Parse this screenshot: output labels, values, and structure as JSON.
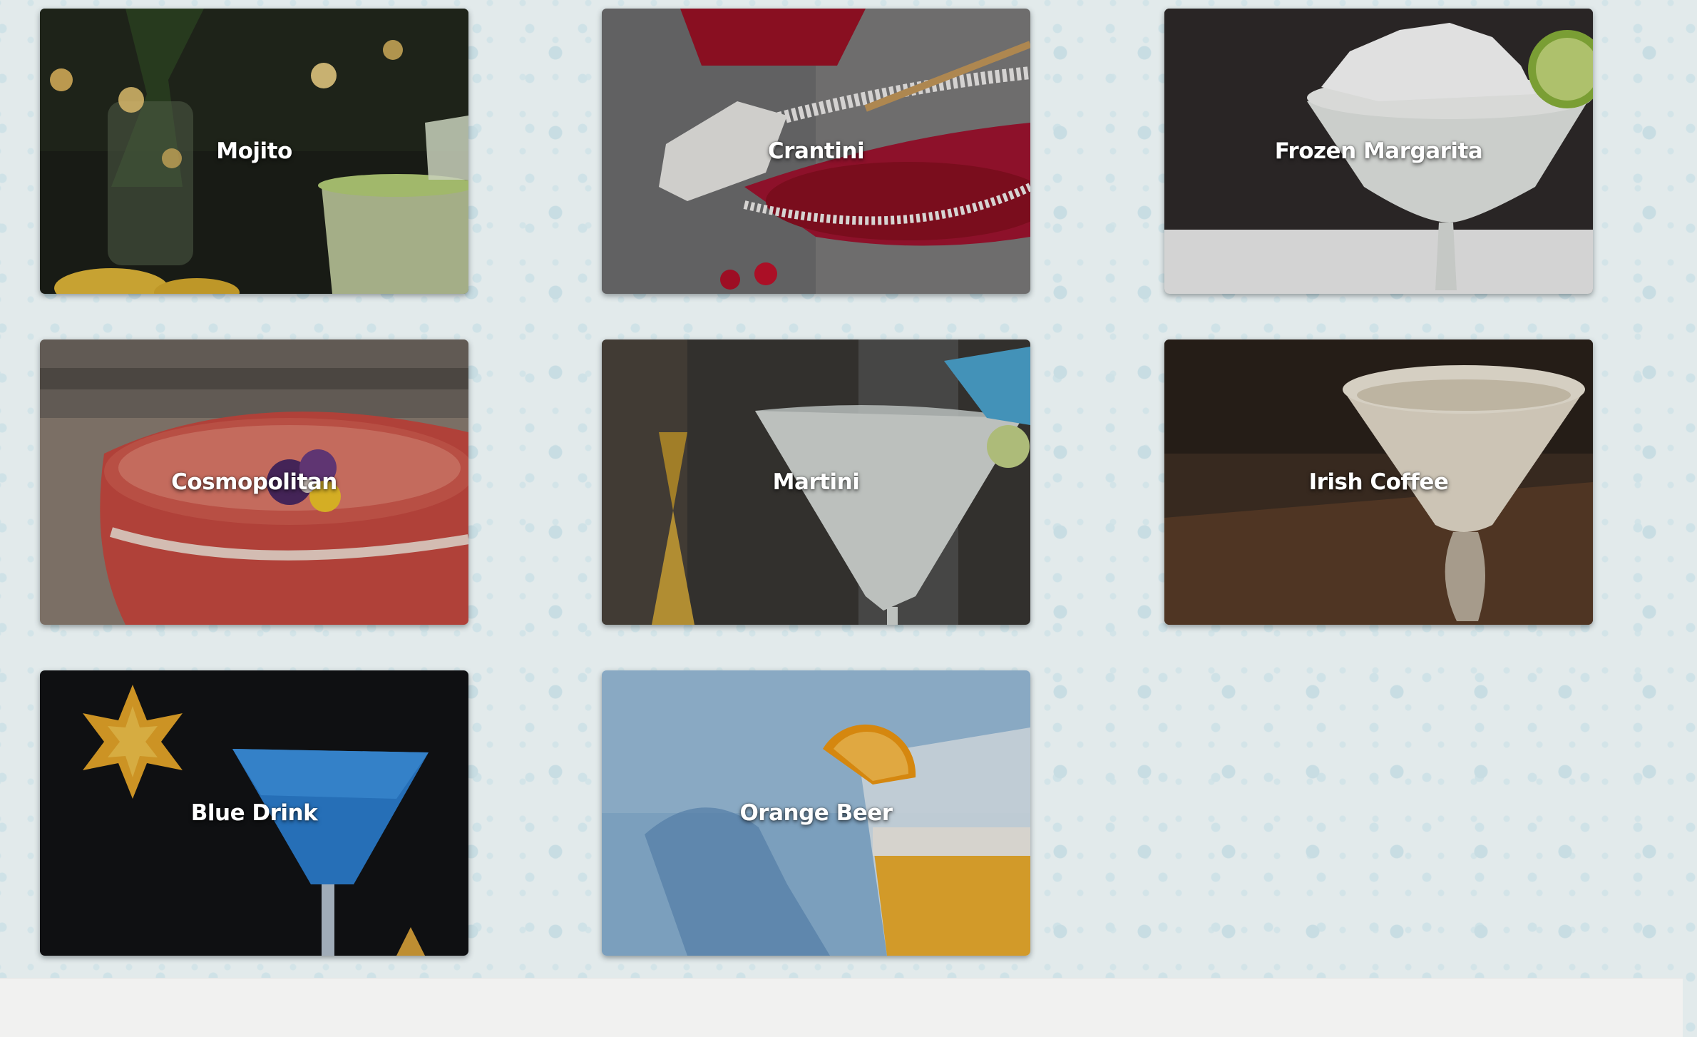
{
  "drinks": [
    {
      "name": "Mojito"
    },
    {
      "name": "Crantini"
    },
    {
      "name": "Frozen Margarita"
    },
    {
      "name": "Cosmopolitan"
    },
    {
      "name": "Martini"
    },
    {
      "name": "Irish Coffee"
    },
    {
      "name": "Blue Drink"
    },
    {
      "name": "Orange Beer"
    }
  ],
  "colors": {
    "background": "#e2eaeb",
    "dots": "#c8dde3",
    "label_text": "#ffffff",
    "footer": "#f1f1f0"
  }
}
